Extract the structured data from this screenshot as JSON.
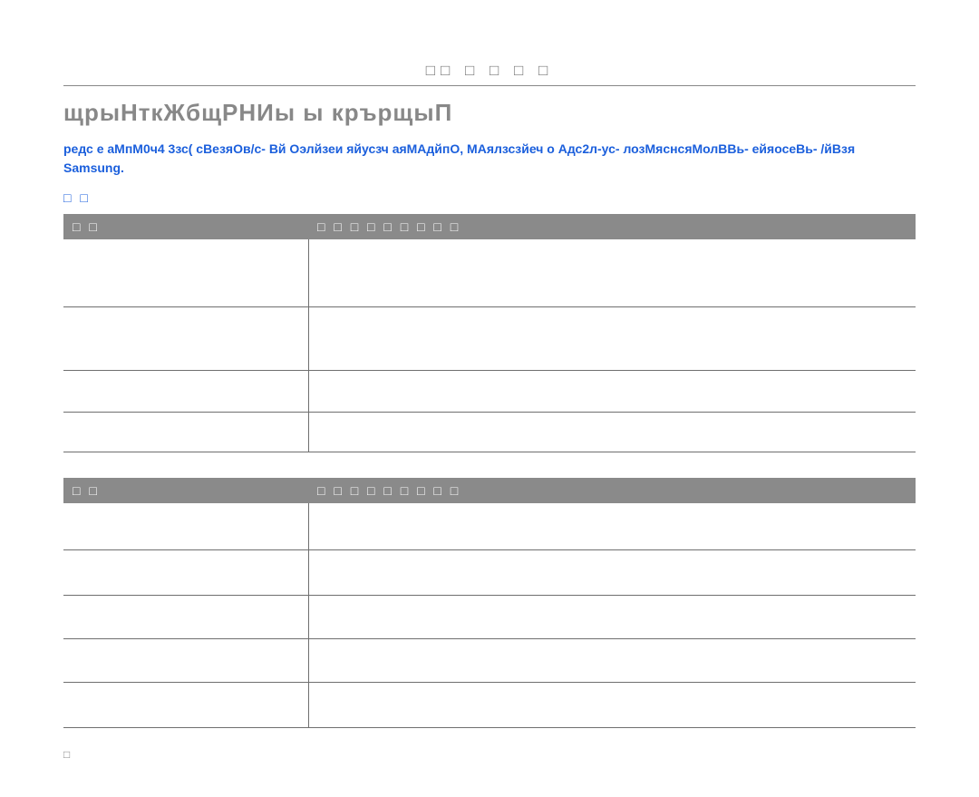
{
  "header": {
    "top_label": "□□ □ □ □ □",
    "section_heading": "щрыНткЖбщРНИы ы крърщыП"
  },
  "notes": {
    "blue_main": "редс е аМпМ0ч4 3зс( сВезяОв/с- Вй Оэлйзеи яйусзч аяМАдйпО, МАялзсзйеч о Адс2л-ус- лозМяснсяМолВВь- ейяосеВь- /йВзя Samsung.",
    "blue_sub": "□ □"
  },
  "table1": {
    "headers": {
      "col_a": "□ □",
      "col_b": "□ □ □ □ □ □ □ □ □"
    },
    "rows": [
      {
        "a": "",
        "b": ""
      },
      {
        "a": "",
        "b": ""
      },
      {
        "a": "",
        "b": ""
      },
      {
        "a": "",
        "b": ""
      }
    ]
  },
  "table2": {
    "headers": {
      "col_a": "□ □",
      "col_b": "□ □ □ □ □ □ □ □ □"
    },
    "rows": [
      {
        "a": "",
        "b": ""
      },
      {
        "a": "",
        "b": ""
      },
      {
        "a": "",
        "b": ""
      },
      {
        "a": "",
        "b": ""
      },
      {
        "a": "",
        "b": ""
      }
    ]
  },
  "footer": {
    "mark": "□"
  }
}
